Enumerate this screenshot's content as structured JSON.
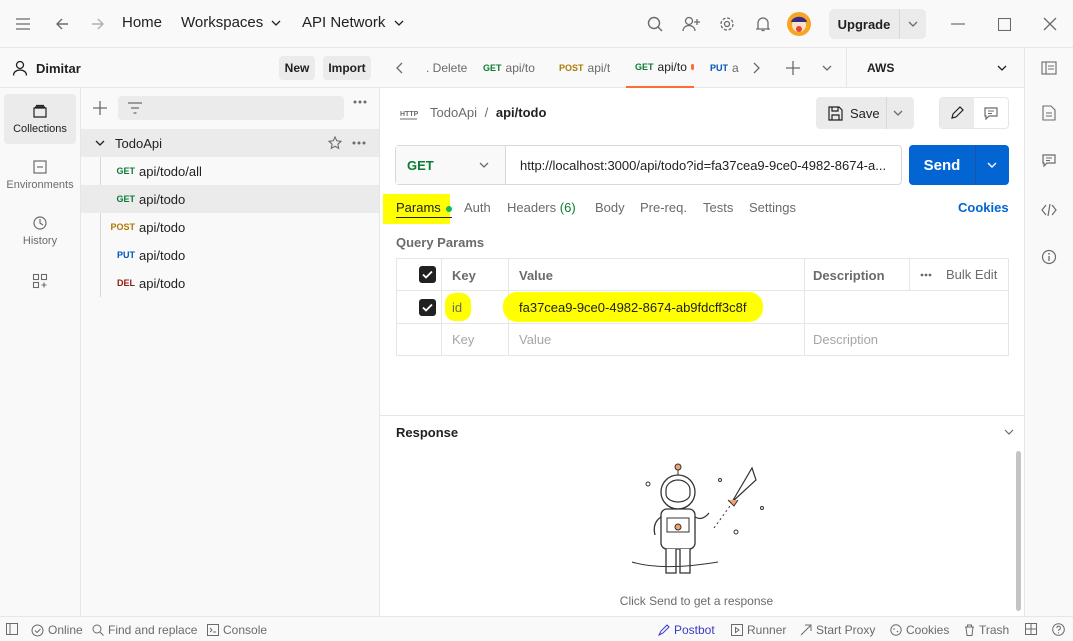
{
  "topbar": {
    "home": "Home",
    "workspaces": "Workspaces",
    "api_network": "API Network",
    "upgrade": "Upgrade"
  },
  "user": {
    "name": "Dimitar"
  },
  "sidebar": {
    "new_label": "New",
    "import_label": "Import",
    "collection_name": "TodoApi",
    "requests": [
      {
        "method": "GET",
        "name": "api/todo/all"
      },
      {
        "method": "GET",
        "name": "api/todo"
      },
      {
        "method": "POST",
        "name": "api/todo"
      },
      {
        "method": "PUT",
        "name": "api/todo"
      },
      {
        "method": "DEL",
        "name": "api/todo"
      }
    ]
  },
  "rail": {
    "collections": "Collections",
    "environments": "Environments",
    "history": "History"
  },
  "tabs": [
    {
      "method": "",
      "name": ". Delete"
    },
    {
      "method": "GET",
      "name": "api/to"
    },
    {
      "method": "POST",
      "name": "api/t"
    },
    {
      "method": "GET",
      "name": "api/to"
    },
    {
      "method": "PUT",
      "name": "a"
    }
  ],
  "environment": "AWS",
  "request": {
    "breadcrumb_collection": "TodoApi",
    "breadcrumb_sep": "/",
    "breadcrumb_request": "api/todo",
    "save": "Save",
    "method": "GET",
    "url": "http://localhost:3000/api/todo?id=fa37cea9-9ce0-4982-8674-a...",
    "send": "Send"
  },
  "subtabs": {
    "params": "Params",
    "auth": "Auth",
    "headers": "Headers",
    "headers_count": "(6)",
    "body": "Body",
    "prereq": "Pre-req.",
    "tests": "Tests",
    "settings": "Settings",
    "cookies": "Cookies"
  },
  "query_params": {
    "title": "Query Params",
    "col_key": "Key",
    "col_value": "Value",
    "col_description": "Description",
    "bulk_edit": "Bulk Edit",
    "rows": [
      {
        "key": "id",
        "value": "fa37cea9-9ce0-4982-8674-ab9fdcff3c8f",
        "description": ""
      }
    ],
    "placeholder_key": "Key",
    "placeholder_value": "Value",
    "placeholder_description": "Description"
  },
  "response": {
    "title": "Response",
    "empty_text": "Click Send to get a response"
  },
  "statusbar": {
    "online": "Online",
    "find_replace": "Find and replace",
    "console": "Console",
    "postbot": "Postbot",
    "runner": "Runner",
    "start_proxy": "Start Proxy",
    "cookies": "Cookies",
    "trash": "Trash"
  },
  "colors": {
    "accent_blue": "#0265d2",
    "highlight": "#ffff00",
    "get": "#0a7c34",
    "post": "#ad7a03",
    "put": "#0053b8",
    "del": "#8e1a10",
    "unsaved_dot": "#ff6c37"
  }
}
